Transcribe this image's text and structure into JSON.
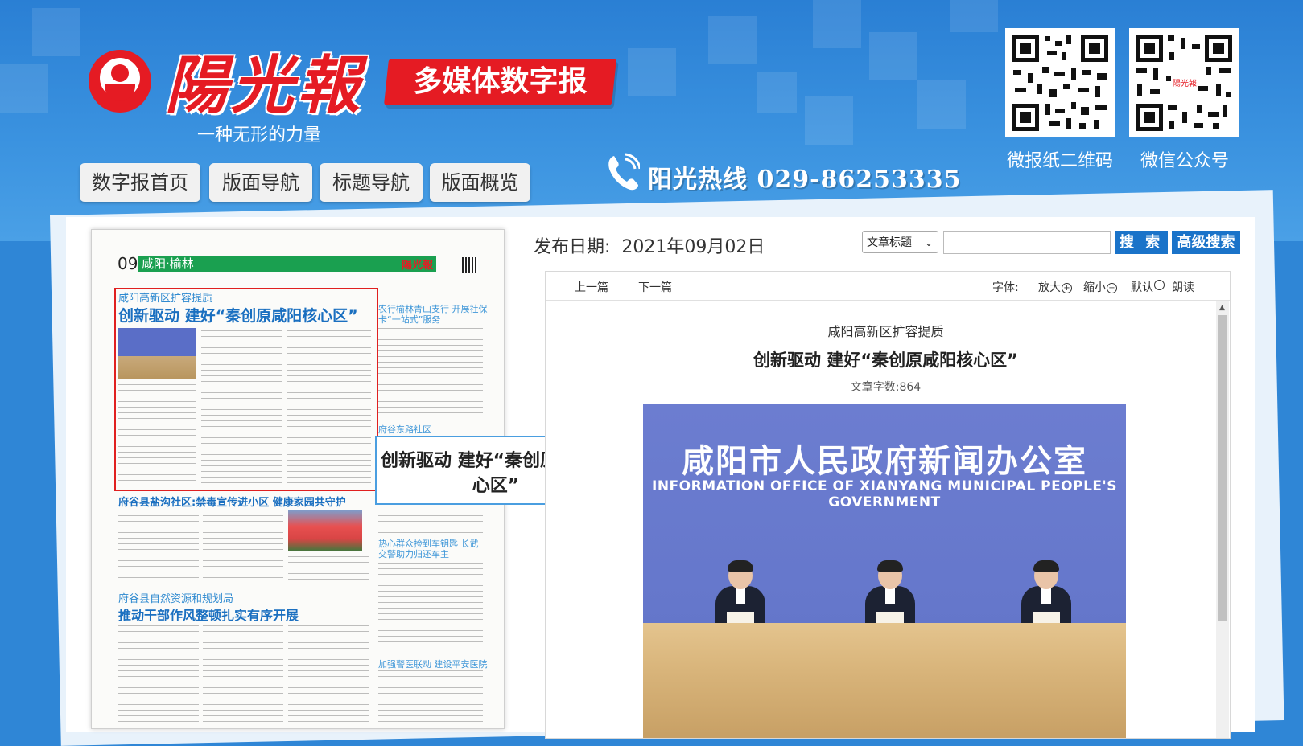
{
  "brand": {
    "logo_text": "陽光報",
    "slogan": "一种无形的力量",
    "badge": "多媒体数字报",
    "hotline": "阳光热线 029-86253335"
  },
  "qr": [
    {
      "label": "微报纸二维码"
    },
    {
      "label": "微信公众号"
    }
  ],
  "nav": [
    "数字报首页",
    "版面导航",
    "标题导航",
    "版面概览"
  ],
  "newspaper": {
    "page_no": "09",
    "page_name": "咸阳·榆林",
    "kicker": "咸阳高新区扩容提质",
    "headline": "创新驱动 建好“秦创原咸阳核心区”",
    "side_headline": "农行榆林青山支行 开展社保卡“一站式”服务",
    "side_sub": "府谷东路社区",
    "story2": "府谷县盐沟社区:禁毒宣传进小区 健康家园共守护",
    "story3_kicker": "府谷县自然资源和规划局",
    "story3": "推动干部作风整顿扎实有序开展",
    "side3": "热心群众捡到车钥匙 长武交警助力归还车主",
    "side4": "加强警医联动 建设平安医院"
  },
  "callout": "创新驱动 建好“秦创原咸阳核心区”",
  "publish": {
    "label": "发布日期:",
    "date": "2021年09月02日"
  },
  "search": {
    "select_value": "文章标题",
    "btn": "搜 索",
    "adv_btn": "高级搜索"
  },
  "toolbar": {
    "prev": "上一篇",
    "next": "下一篇",
    "font_label": "字体:",
    "zoom_in": "放大",
    "zoom_out": "缩小",
    "default": "默认",
    "read": "朗读"
  },
  "article": {
    "kicker": "咸阳高新区扩容提质",
    "title": "创新驱动 建好“秦创原咸阳核心区”",
    "word_count": "文章字数:864",
    "photo_cn": "咸阳市人民政府新闻办公室",
    "photo_en": "INFORMATION OFFICE OF XIANYANG MUNICIPAL PEOPLE'S GOVERNMENT"
  },
  "colors": {
    "header_blue": "#2f86d6",
    "brand_red": "#e51b23",
    "button_blue": "#1a73c9",
    "page_green": "#1aa050"
  }
}
